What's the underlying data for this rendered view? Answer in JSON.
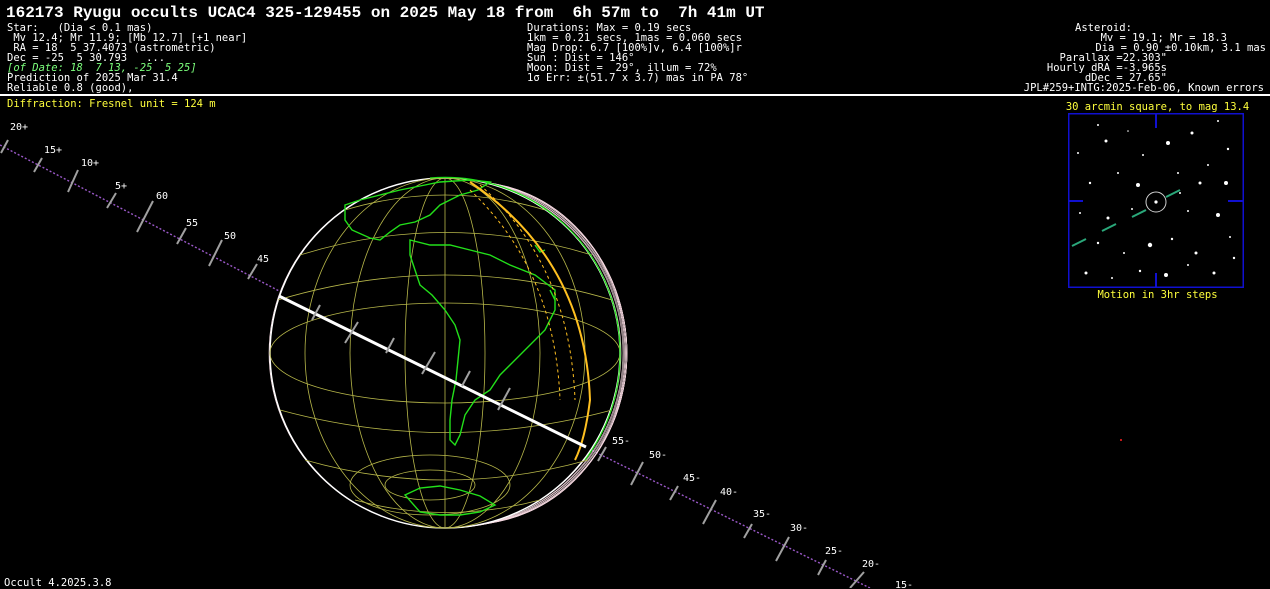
{
  "header": {
    "title": "162173 Ryugu occults UCAC4 325-129455 on 2025 May 18 from  6h 57m to  7h 41m UT"
  },
  "star_block": {
    "line1": "Star:   (Dia < 0.1 mas)",
    "line2": " Mv 12.4; Mr 11.9; [Mb 12.7] [+1 near]",
    "line3": " RA = 18  5 37.4073 (astrometric)",
    "line4": "Dec = -25  5 30.793   ...",
    "line5": "[of Date: 18  7 13, -25  5 25]",
    "line6": "Prediction of 2025 Mar 31.4",
    "line7": "Reliable 0.8 (good),"
  },
  "event_block": {
    "line1": "Durations: Max = 0.19 secs",
    "line2": "1km = 0.21 secs, 1mas = 0.060 secs",
    "line3": "Mag Drop: 6.7 [100%]v, 6.4 [100%]r",
    "line4": "Sun : Dist = 146°",
    "line5": "Moon: Dist =  29°, illum = 72%",
    "line6": "1σ Err: ±(51.7 x 3.7) mas in PA 78°"
  },
  "asteroid_block": {
    "line1": "Asteroid:",
    "line2": "Mv = 19.1; Mr = 18.3",
    "line3": "Dia = 0.90 ±0.10km, 3.1 mas",
    "line4": "Parallax =22.303\"",
    "line5": "Hourly dRA =-3.965s",
    "line6": "dDec = 27.65\"",
    "line7": "JPL#259+INTG:2025-Feb-06, Known errors"
  },
  "diffraction": "Diffraction: Fresnel unit = 124 m",
  "inset": {
    "title": "30 arcmin square, to mag 13.4",
    "caption": "Motion in 3hr steps"
  },
  "footer": "Occult 4.2025.3.8",
  "colors": {
    "background": "#000000",
    "continents": "#22e01a",
    "grid": "#b8b84a",
    "path": "#ffffff",
    "limit": "#ffc020",
    "track": "#9b59c9",
    "inset_frame": "#1010d0"
  },
  "track_labels_upper": [
    "20+",
    "15+",
    "10+",
    "5+",
    "60",
    "55",
    "50",
    "45"
  ],
  "track_labels_lower": [
    "55-",
    "50-",
    "45-",
    "40-",
    "35-",
    "30-",
    "25-",
    "20-",
    "15-"
  ]
}
